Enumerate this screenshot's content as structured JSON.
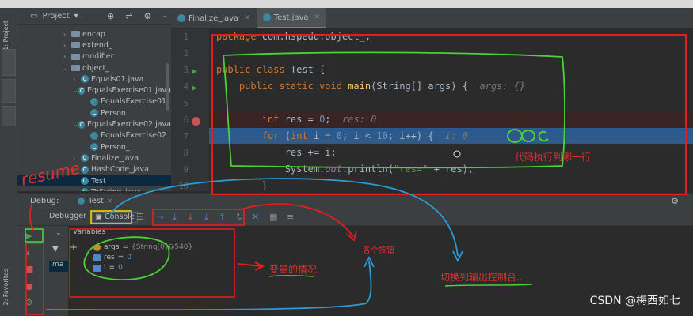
{
  "project_panel": {
    "title": "Project",
    "tree": [
      {
        "label": "encap",
        "kind": "folder",
        "indent": 1,
        "arrow": "›"
      },
      {
        "label": "extend_",
        "kind": "folder",
        "indent": 1,
        "arrow": "›"
      },
      {
        "label": "modifier",
        "kind": "folder",
        "indent": 1,
        "arrow": "›"
      },
      {
        "label": "object_",
        "kind": "folder",
        "indent": 1,
        "arrow": "⌄"
      },
      {
        "label": "Equals01.java",
        "kind": "class",
        "indent": 2,
        "arrow": "›"
      },
      {
        "label": "EqualsExercise01.java",
        "kind": "class",
        "indent": 2,
        "arrow": "⌄"
      },
      {
        "label": "EqualsExercise01",
        "kind": "class",
        "indent": 3,
        "arrow": ""
      },
      {
        "label": "Person",
        "kind": "class",
        "indent": 3,
        "arrow": ""
      },
      {
        "label": "EqualsExercise02.java",
        "kind": "class",
        "indent": 2,
        "arrow": "⌄"
      },
      {
        "label": "EqualsExercise02",
        "kind": "class",
        "indent": 3,
        "arrow": ""
      },
      {
        "label": "Person_",
        "kind": "class",
        "indent": 3,
        "arrow": ""
      },
      {
        "label": "Finalize_java",
        "kind": "class",
        "indent": 2,
        "arrow": "›"
      },
      {
        "label": "HashCode_java",
        "kind": "class",
        "indent": 2,
        "arrow": "›"
      },
      {
        "label": "Test",
        "kind": "class",
        "indent": 2,
        "arrow": "",
        "selected": true
      },
      {
        "label": "ToString_java",
        "kind": "class",
        "indent": 2,
        "arrow": ""
      }
    ]
  },
  "left_strip": {
    "project_tab": "1: Project",
    "favorites_tab": "2: Favorites"
  },
  "editor": {
    "tabs": [
      {
        "label": "Finalize_java",
        "active": false
      },
      {
        "label": "Test.java",
        "active": true
      }
    ],
    "line_numbers": [
      "1",
      "2",
      "3",
      "4",
      "5",
      "6",
      "7",
      "8",
      "9",
      "10"
    ]
  },
  "debugger": {
    "window_title": "Debug:",
    "run_tab": "Test",
    "debugger_tab": "Debugger",
    "console_tab": "Console",
    "variables_title": "Variables",
    "frame_label": "ma",
    "variables": [
      {
        "name": "args",
        "value": "{String[0]@540}",
        "kind": "object"
      },
      {
        "name": "res",
        "value": "0",
        "kind": "int"
      },
      {
        "name": "i",
        "value": "0",
        "kind": "int"
      }
    ]
  },
  "annotations": {
    "resume": "resume",
    "current_line": "代码执行到哪一行",
    "variables_state": "变量的情况",
    "step_buttons": "各个按钮",
    "switch_console": "切换到输出控制台..",
    "circle_mark": "OO c"
  },
  "watermark": "CSDN @梅西如七"
}
